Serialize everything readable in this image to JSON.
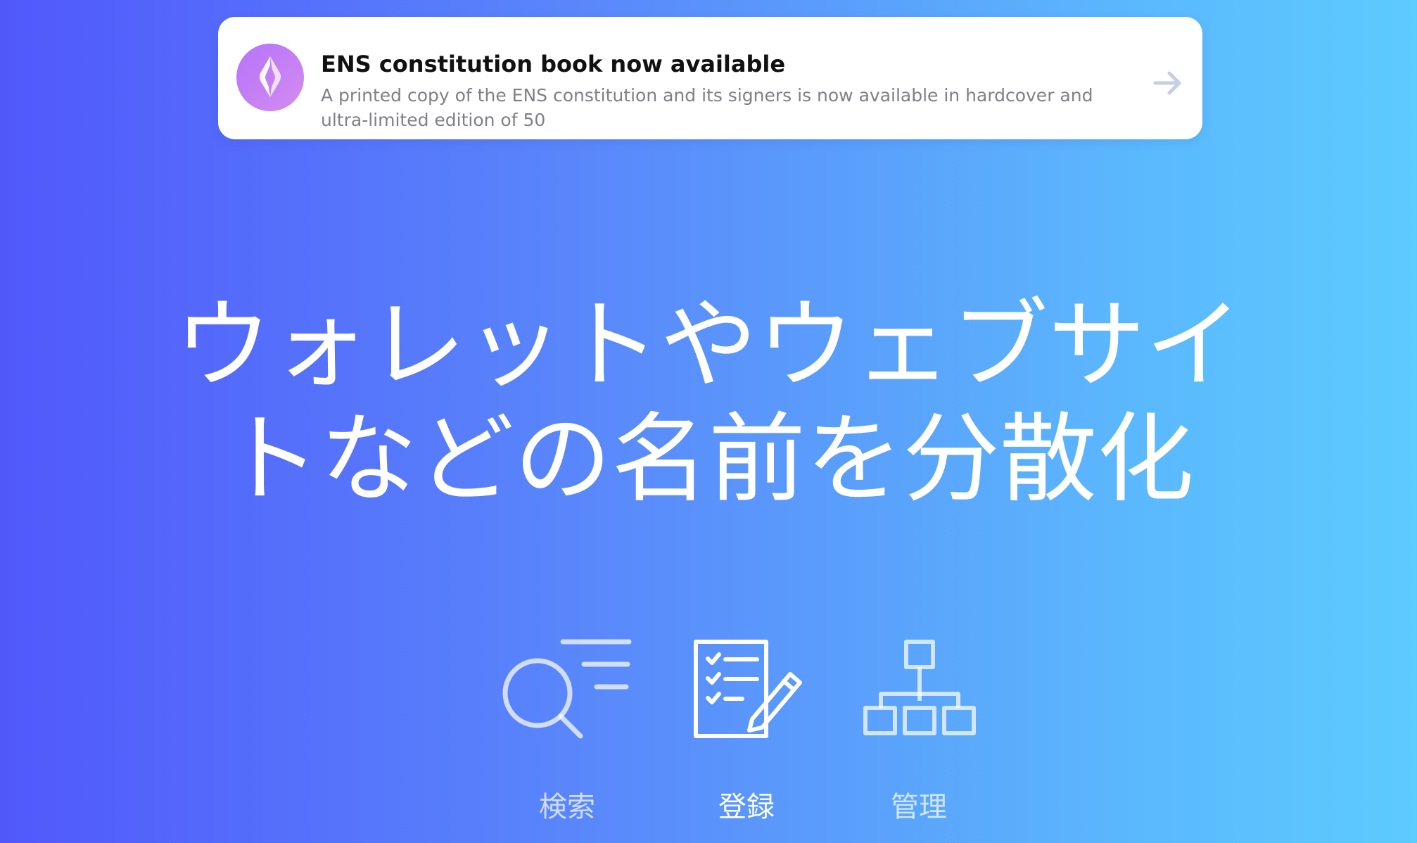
{
  "banner": {
    "title": "ENS constitution book now available",
    "description": "A printed copy of the ENS constitution and its signers is now available in hardcover and ultra-limited edition of 50",
    "logo_icon": "ens-logo-icon",
    "arrow_icon": "arrow-right-icon"
  },
  "hero": {
    "line1": "ウォレットやウェブサイ",
    "line2": "トなどの名前を分散化"
  },
  "features": [
    {
      "label": "検索",
      "icon": "search-icon",
      "active": false
    },
    {
      "label": "登録",
      "icon": "checklist-pen-icon",
      "active": true
    },
    {
      "label": "管理",
      "icon": "hierarchy-icon",
      "active": false
    }
  ],
  "colors": {
    "gradient_start": "#5158fb",
    "gradient_end": "#5ccbfe",
    "logo_purple": "#c47ff4",
    "banner_text": "#111111",
    "banner_subtext": "#7f7f87"
  }
}
